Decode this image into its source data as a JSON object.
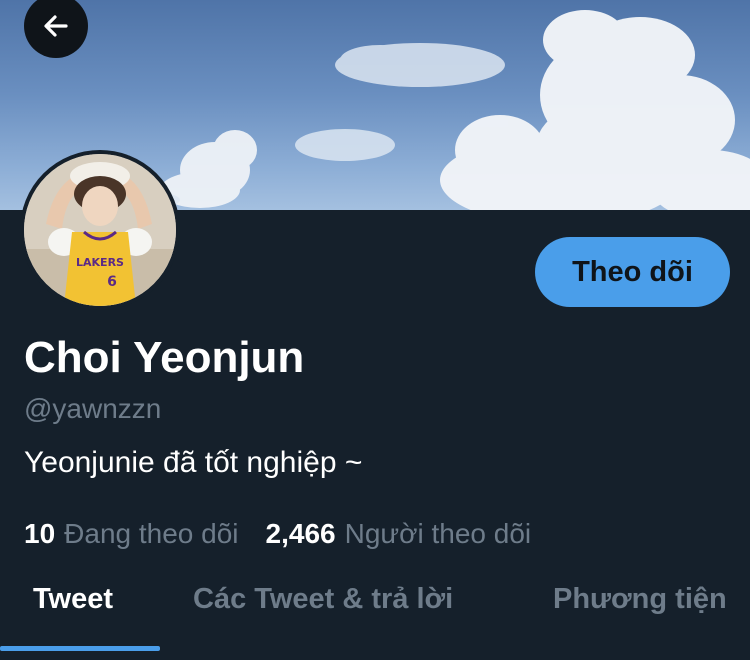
{
  "profile": {
    "display_name": "Choi Yeonjun",
    "handle": "@yawnzzn",
    "bio": "Yeonjunie đã tốt nghiệp ~",
    "follow_label": "Theo dõi"
  },
  "stats": {
    "following_count": "10",
    "following_label": "Đang theo dõi",
    "followers_count": "2,466",
    "followers_label": "Người theo dõi"
  },
  "tabs": [
    {
      "label": "Tweet",
      "active": true
    },
    {
      "label": "Các Tweet & trả lời",
      "active": false
    },
    {
      "label": "Phương tiện",
      "active": false
    }
  ],
  "icons": {
    "back": "arrow-left-icon"
  },
  "colors": {
    "background": "#15202b",
    "accent": "#4a9eea",
    "muted_text": "#6e7c8a"
  }
}
